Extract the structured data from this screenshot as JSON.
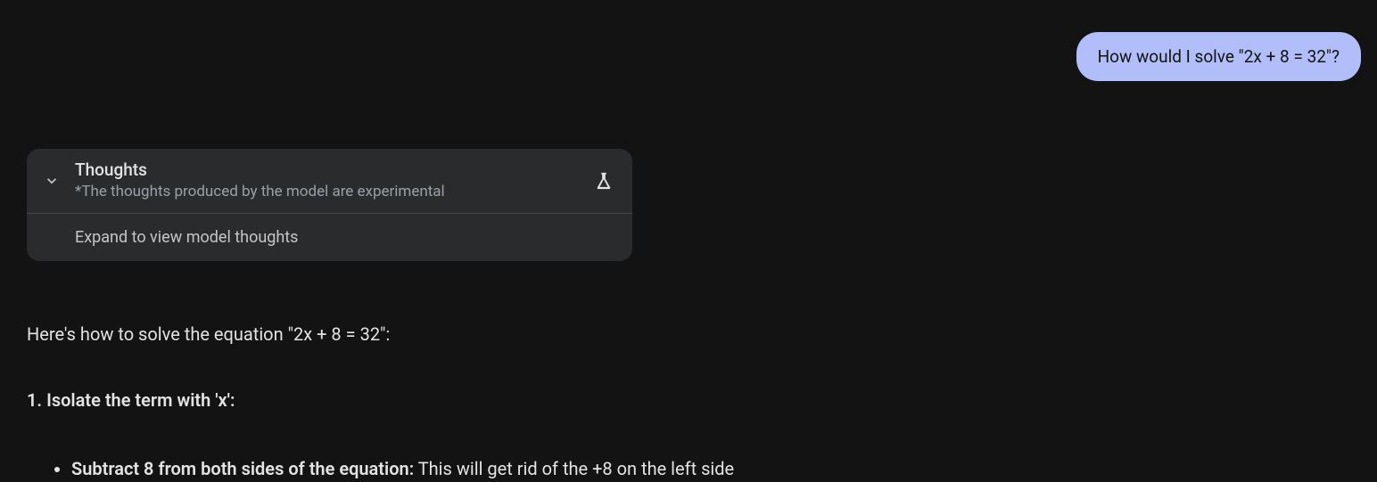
{
  "user_message": {
    "text": "How would I solve \"2x + 8 = 32\"?"
  },
  "thoughts_panel": {
    "title": "Thoughts",
    "subtitle": "*The thoughts produced by the model are experimental",
    "expand_text": "Expand to view model thoughts"
  },
  "response": {
    "intro": "Here's how to solve the equation \"2x + 8 = 32\":",
    "step_heading": "1. Isolate the term with 'x':",
    "bullet_bold": "Subtract 8 from both sides of the equation:",
    "bullet_rest": " This will get rid of the +8 on the left side"
  }
}
